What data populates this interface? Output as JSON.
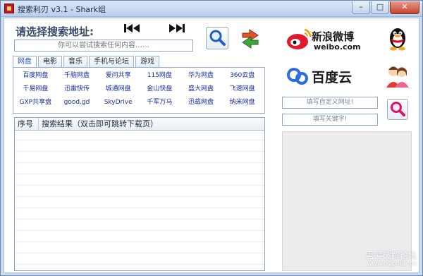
{
  "window": {
    "title": "搜索利刃 v3.1 - Shark组",
    "buttons": {
      "minimize": "–",
      "maximize": "□",
      "close": "✕"
    }
  },
  "header": {
    "label": "请选择搜索地址:",
    "search_placeholder": "你可以尝试搜索任何内容……"
  },
  "brands": {
    "weibo_cn": "新浪微博",
    "weibo_en": "weibo.com",
    "baidu": "百度云"
  },
  "tabs": [
    "网盘",
    "电影",
    "音乐",
    "手机与论坛",
    "游戏"
  ],
  "sites": [
    "百度网盘",
    "千脑网盘",
    "爱问共享",
    "115网盘",
    "华为网盘",
    "360云盘",
    "千易网盘",
    "迅雷快传",
    "城通网盘",
    "金山快盘",
    "盛大网盘",
    "飞速网盘",
    "GXP共享盘",
    "good.gd",
    "SkyDrive",
    "千军万马",
    "迅载网盘",
    "纳米网盘"
  ],
  "results": {
    "col_index": "序号",
    "col_result": "搜索结果（双击即可跳转下载页）"
  },
  "side": {
    "custom_url_placeholder": "填写自定义网址!",
    "keyword_placeholder": "填写关键字!"
  },
  "watermark": {
    "text": "吾爱破解论坛",
    "url": "www.52pojie.cn"
  },
  "colors": {
    "weibo_red": "#e6162d",
    "baidu_blue": "#2d6be4",
    "link_blue": "#1a2d9c"
  }
}
